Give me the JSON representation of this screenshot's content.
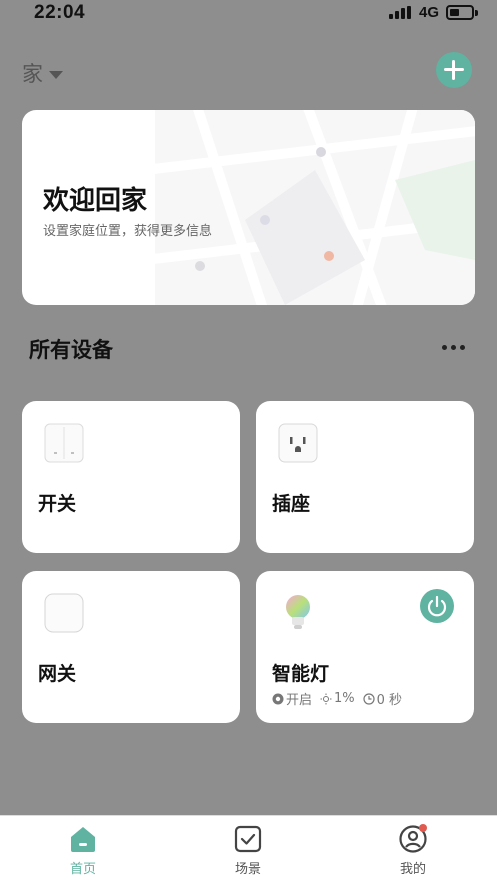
{
  "status_bar": {
    "time": "22:04",
    "network": "4G"
  },
  "header": {
    "home_name": "家"
  },
  "welcome": {
    "title": "欢迎回家",
    "subtitle": "设置家庭位置，获得更多信息"
  },
  "devices_section": {
    "title": "所有设备"
  },
  "devices": [
    {
      "name": "开关",
      "icon": "wall-switch-icon"
    },
    {
      "name": "插座",
      "icon": "socket-icon"
    },
    {
      "name": "网关",
      "icon": "gateway-icon"
    },
    {
      "name": "智能灯",
      "icon": "smart-bulb-icon",
      "power_on": true,
      "status": {
        "state": "开启",
        "brightness": "1%",
        "timer": "0 秒"
      }
    }
  ],
  "tabs": [
    {
      "label": "首页",
      "icon": "home-icon",
      "active": true
    },
    {
      "label": "场景",
      "icon": "scene-checkbox-icon",
      "active": false
    },
    {
      "label": "我的",
      "icon": "profile-icon",
      "active": false,
      "badge": true
    }
  ],
  "colors": {
    "accent": "#5fb3a0",
    "active_tab": "#5fb3a0",
    "inactive_tab": "#555555",
    "badge": "#e05a4f",
    "overlay": "#8e8e8e"
  }
}
